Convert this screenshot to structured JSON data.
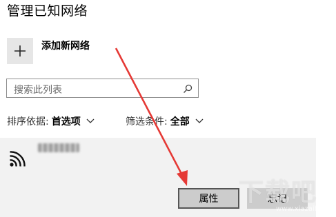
{
  "page": {
    "title": "管理已知网络"
  },
  "add_network": {
    "label": "添加新网络",
    "icon": "plus-icon"
  },
  "search": {
    "placeholder": "搜索此列表",
    "icon": "search-icon"
  },
  "sort": {
    "label": "排序依据:",
    "value": "首选项"
  },
  "filter": {
    "label": "筛选条件:",
    "value": "全部"
  },
  "network_item": {
    "icon": "wifi-icon"
  },
  "buttons": {
    "properties": "属性",
    "forget": "忘记"
  },
  "watermark": {
    "text": "下载吧",
    "url": "www.xiazaiba.com"
  },
  "colors": {
    "arrow": "#e53935",
    "panel": "#f2f2f2",
    "button": "#cccccc"
  }
}
